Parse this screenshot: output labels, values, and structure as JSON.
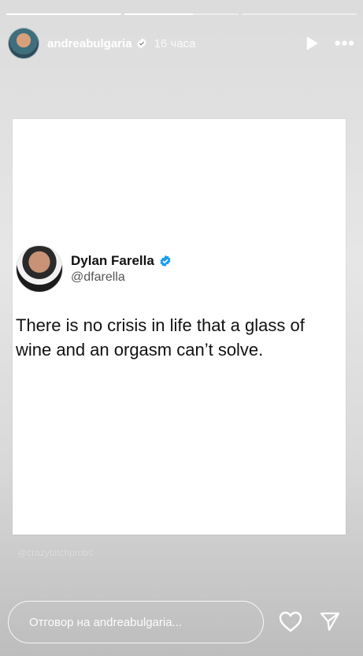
{
  "progress": [
    1.0,
    0.6,
    0.0
  ],
  "header": {
    "username": "andreabulgaria",
    "time": "16 часа",
    "more_label": "•••"
  },
  "tweet": {
    "name": "Dylan Farella",
    "handle": "@dfarella",
    "text": "There is no crisis in life that a glass of wine and an orgasm can’t solve."
  },
  "watermark": "@crazybitchprobs",
  "reply": {
    "placeholder": "Отговор на andreabulgaria..."
  },
  "colors": {
    "verified": "#3897f0",
    "twitter_check": "#1d9bf0"
  },
  "icons": [
    "verified-badge-icon",
    "play-icon",
    "more-options-icon",
    "heart-icon",
    "send-icon"
  ]
}
